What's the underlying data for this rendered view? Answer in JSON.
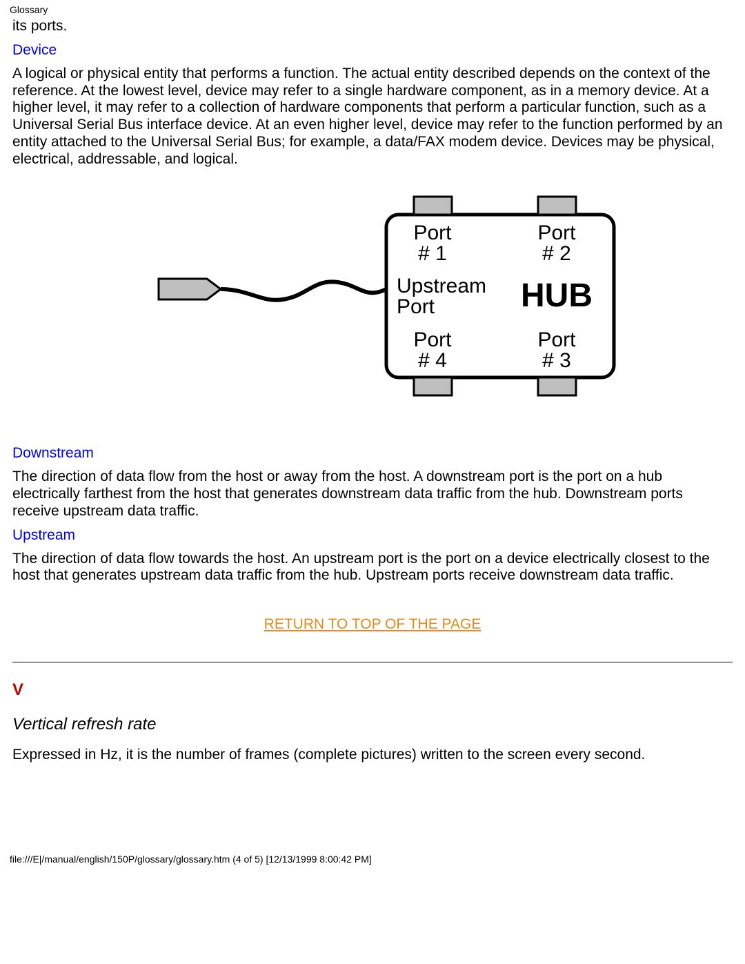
{
  "header": {
    "title": "Glossary"
  },
  "intro_fragment": "its ports.",
  "terms": {
    "device": {
      "label": "Device",
      "text": "A logical or physical entity that performs a function. The actual entity described depends on the context of the reference. At the lowest level, device may refer to a single hardware component, as in a memory device. At a higher level, it may refer to a collection of hardware components that perform a particular function, such as a Universal Serial Bus interface device. At an even higher level, device may refer to the function performed by an entity attached to the Universal Serial Bus; for example, a data/FAX modem device. Devices may be physical, electrical, addressable, and logical."
    },
    "downstream": {
      "label": "Downstream",
      "text": "The direction of data flow from the host or away from the host. A downstream port is the port on a hub electrically farthest from the host that generates downstream data traffic from the hub. Downstream ports receive upstream data traffic."
    },
    "upstream": {
      "label": "Upstream",
      "text": "The direction of data flow towards the host. An upstream port is the port on a device electrically closest to the host that generates upstream data traffic from the hub. Upstream ports receive downstream data traffic."
    }
  },
  "diagram": {
    "port1_l1": "Port",
    "port1_l2": "# 1",
    "port2_l1": "Port",
    "port2_l2": "# 2",
    "port3_l1": "Port",
    "port3_l2": "# 3",
    "port4_l1": "Port",
    "port4_l2": "# 4",
    "upstream_l1": "Upstream",
    "upstream_l2": "Port",
    "hub": "HUB"
  },
  "return_link": "RETURN TO TOP OF THE PAGE",
  "section_v": {
    "letter": "V",
    "sub": "Vertical refresh rate",
    "text": "Expressed in Hz, it is the number of frames (complete pictures) written to the screen every second."
  },
  "footer": "file:///E|/manual/english/150P/glossary/glossary.htm (4 of 5) [12/13/1999 8:00:42 PM]"
}
